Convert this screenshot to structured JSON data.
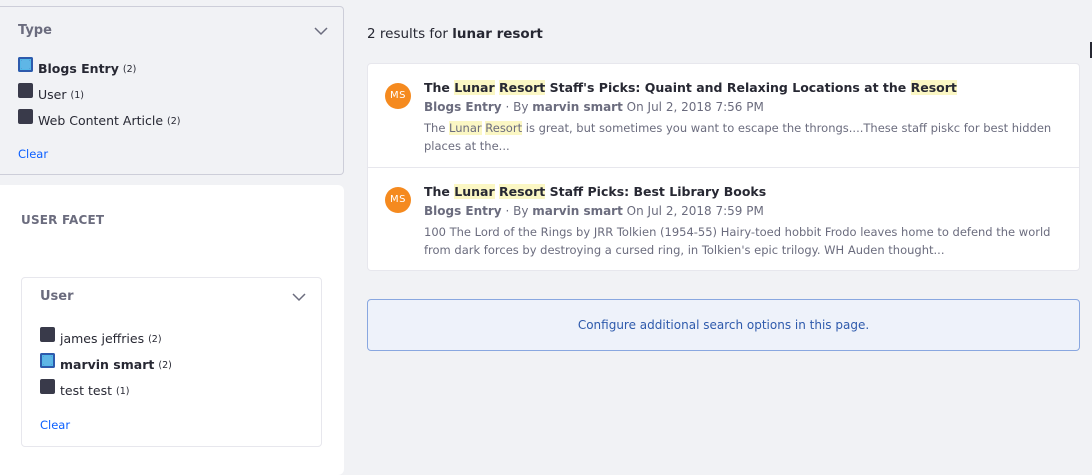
{
  "type_facet": {
    "title": "Type",
    "items": [
      {
        "label": "Blogs Entry",
        "count": "(2)",
        "checked": true
      },
      {
        "label": "User",
        "count": "(1)",
        "checked": false
      },
      {
        "label": "Web Content Article",
        "count": "(2)",
        "checked": false
      }
    ],
    "clear_label": "Clear"
  },
  "user_facet": {
    "heading": "USER FACET",
    "title": "User",
    "items": [
      {
        "label": "james jeffries",
        "count": "(2)",
        "checked": false
      },
      {
        "label": "marvin smart",
        "count": "(2)",
        "checked": true
      },
      {
        "label": "test test",
        "count": "(1)",
        "checked": false
      }
    ],
    "clear_label": "Clear"
  },
  "summary": {
    "prefix": "2 results for",
    "query": "lunar resort"
  },
  "results": [
    {
      "avatar": "MS",
      "title_parts": [
        "The ",
        "Lunar",
        " ",
        "Resort",
        " Staff's Picks: Quaint and Relaxing Locations at the ",
        "Resort",
        ""
      ],
      "type": "Blogs Entry",
      "by": "· By",
      "author": "marvin smart",
      "date": "On Jul 2, 2018 7:56 PM",
      "snippet_parts": [
        "The ",
        "Lunar",
        " ",
        "Resort",
        " is great, but sometimes you want to escape the throngs....These staff piskc for best hidden places at the..."
      ]
    },
    {
      "avatar": "MS",
      "title_parts": [
        "The ",
        "Lunar",
        " ",
        "Resort",
        " Staff Picks: Best Library Books"
      ],
      "type": "Blogs Entry",
      "by": "· By",
      "author": "marvin smart",
      "date": "On Jul 2, 2018 7:59 PM",
      "snippet_parts": [
        "100 The Lord of the Rings by JRR Tolkien (1954-55) Hairy-toed hobbit Frodo leaves home to defend the world from dark forces by destroying a cursed ring, in Tolkien's epic trilogy. WH Auden thought..."
      ]
    }
  ],
  "config_link": "Configure additional search options in this page.",
  "colors": {
    "avatar": "#f58a1f",
    "highlight": "#fbf7c4",
    "link": "#0b5fff"
  }
}
